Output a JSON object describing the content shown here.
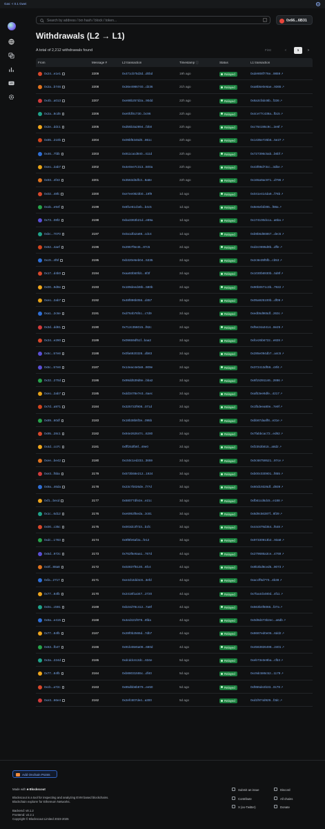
{
  "topbar": {
    "gas": "Gas: < 0.1 Gwei"
  },
  "search": {
    "placeholder": "Search by address / txn hash / block / token...",
    "kbd": "/"
  },
  "wallet": {
    "address": "0x66...6B31"
  },
  "page": {
    "title": "Withdrawals (L2 → L1)",
    "total_text": "A total of 2,212 withdrawals found"
  },
  "pagination": {
    "first": "First",
    "prev": "<",
    "current": "1",
    "next": ">"
  },
  "table": {
    "headers": {
      "from": "From",
      "msg": "Message #",
      "l2": "L2 transaction",
      "ts": "Timestamp",
      "status": "Status",
      "l1": "L1 transaction"
    },
    "rows": [
      {
        "from": "0x24...e1e1",
        "msg": "2209",
        "l2": "0x471cb75d3d...d0bd",
        "ts": "19h ago",
        "status": "Relayed",
        "l1": "0xde908f776e...9859",
        "av": "#d9472b"
      },
      {
        "from": "0x2a...b746",
        "msg": "2208",
        "l2": "0x36e4986740...d236",
        "ts": "21h ago",
        "status": "Relayed",
        "l1": "0xa8b5e0e6ae...9365",
        "av": "#e0731f"
      },
      {
        "from": "0x4b...a013",
        "msg": "2207",
        "l2": "0xe88b257d2a...90dd",
        "ts": "22h ago",
        "status": "Relayed",
        "l1": "0x8a3cfab46b...f336",
        "av": "#d23b3b"
      },
      {
        "from": "0x2a...8cd5",
        "msg": "2206",
        "l2": "0xe0fdf4c730...bc96",
        "ts": "22h ago",
        "status": "Relayed",
        "l1": "0x4ce77c439a...fb15",
        "av": "#1fa38a"
      },
      {
        "from": "0x2e...ddc1",
        "msg": "2205",
        "ts": "22h ago",
        "l2": "0xd55b3a2894...f2b0",
        "status": "Relayed",
        "l1": "0xc764195c9c...2e6f",
        "av": "#f0a61c"
      },
      {
        "from": "0x85...210b",
        "msg": "2204",
        "l2": "0x09bf6346d0...861c",
        "ts": "22h ago",
        "status": "Relayed",
        "l1": "0x1435e725b5...5e27",
        "av": "#d2451e"
      },
      {
        "from": "0x46...7fdb",
        "msg": "2203",
        "l2": "0x911cacd840...411d",
        "ts": "22h ago",
        "status": "Relayed",
        "l1": "0x727396c5ab...b6bf",
        "av": "#2e6fd6"
      },
      {
        "from": "0xeo...2ab7",
        "msg": "2202",
        "l2": "0x4e0ee7c313...500a",
        "ts": "22h ago",
        "status": "Relayed",
        "l1": "0x43f86d73cc...3dbe",
        "av": "#e8a317"
      },
      {
        "from": "0x93...4f43",
        "msg": "2201",
        "l2": "0x3563d3dfc3...8a8e",
        "ts": "22h ago",
        "status": "Relayed",
        "l1": "0x165a9ac971...d796",
        "av": "#e0731f"
      },
      {
        "from": "0x02...48fc",
        "msg": "2200",
        "l2": "0xe7ee0823b0...19f9",
        "ts": "1d ago",
        "status": "Relayed",
        "l1": "0x041e414da9...f76b",
        "av": "#d9472b"
      },
      {
        "from": "0xob...e94f",
        "msg": "2199",
        "l2": "0x6f1e61cbeb...b4c5",
        "ts": "1d ago",
        "status": "Relayed",
        "l1": "0x8e6efaf285...f88a",
        "av": "#27a34a"
      },
      {
        "from": "0x73...08f2",
        "msg": "2198",
        "l2": "0xba3363b21d...e89a",
        "ts": "1d ago",
        "status": "Relayed",
        "l1": "0x174100dcca...a6ba",
        "av": "#5a4fd6"
      },
      {
        "from": "0xbc...7070",
        "msg": "2197",
        "l2": "0x0a1dfa2a88...cdc4",
        "ts": "1d ago",
        "status": "Relayed",
        "l1": "0xb9b6d66867...dec5",
        "av": "#1fa38a"
      },
      {
        "from": "0x62...4aef",
        "msg": "2196",
        "l2": "0x2957f9e46...87c5",
        "ts": "2d ago",
        "status": "Relayed",
        "l1": "0xd2c0695d9b...dffe",
        "av": "#d2451e"
      },
      {
        "from": "0xc9...4f5f",
        "msg": "2195",
        "l2": "0xb320e5eb04...5335",
        "ts": "2d ago",
        "status": "Relayed",
        "l1": "0x2c8e39f5fb...cb53",
        "av": "#2e6fd6"
      },
      {
        "from": "0x17...d4b0",
        "msg": "2194",
        "l2": "0xaa93b50fdc...6f3f",
        "ts": "2d ago",
        "status": "Relayed",
        "l1": "0x1030b6930b...5d8f",
        "av": "#d9472b"
      },
      {
        "from": "0x00...9d9e",
        "msg": "2193",
        "l2": "0x189deed48b...580b",
        "ts": "2d ago",
        "status": "Relayed",
        "l1": "0x90b0671c3b...7922",
        "av": "#f0a61c"
      },
      {
        "from": "0xeo...2ab7",
        "msg": "2192",
        "l2": "0x48f896b056...d457",
        "ts": "2d ago",
        "status": "Relayed",
        "l1": "0x05a925100b...df09",
        "av": "#e8a317"
      },
      {
        "from": "0xa1...2c6e",
        "msg": "2191",
        "l2": "0xd764b76f4c...c7d9",
        "ts": "2d ago",
        "status": "Relayed",
        "l1": "0xedb5d965df...263c",
        "av": "#2e6fd6"
      },
      {
        "from": "0x3d...dd81",
        "msg": "2190",
        "l2": "0x712c356015...f82c",
        "ts": "2d ago",
        "status": "Relayed",
        "l1": "0xf5e24a3414...8e25",
        "av": "#d23b3b"
      },
      {
        "from": "0x34...e290",
        "msg": "2189",
        "l2": "0x09659df51f...baa2",
        "ts": "2d ago",
        "status": "Relayed",
        "l1": "0xfce26b6722...e828",
        "av": "#d9472b"
      },
      {
        "from": "0x6c...57e8",
        "msg": "2188",
        "l2": "0x0fa6920328...db83",
        "ts": "2d ago",
        "status": "Relayed",
        "l1": "0x285e094db7...a4c5",
        "av": "#5a4fd6"
      },
      {
        "from": "0x5c...57e8",
        "msg": "2187",
        "l2": "0x14eac4e0a9...909e",
        "ts": "2d ago",
        "status": "Relayed",
        "l1": "0x372413df59...c8f4",
        "av": "#5a4fd6"
      },
      {
        "from": "0x32...270d",
        "msg": "2186",
        "l2": "0x99dd539d8e...bba2",
        "ts": "2d ago",
        "status": "Relayed",
        "l1": "0x6f15391146...2886",
        "av": "#27a34a"
      },
      {
        "from": "0xeo...2ab7",
        "msg": "2185",
        "l2": "0xdd3478e7e3...6aec",
        "ts": "2d ago",
        "status": "Relayed",
        "l1": "0xafb3ee9dfe...4217",
        "av": "#e8a317"
      },
      {
        "from": "0x7d...a971",
        "msg": "2184",
        "l2": "0x325722f908...071d",
        "ts": "2d ago",
        "status": "Relayed",
        "l1": "0x1fbdeea80e...7e9f",
        "av": "#d2451e"
      },
      {
        "from": "0x89...60df",
        "msg": "2183",
        "l2": "0x18b38b6f3e...095b",
        "ts": "2d ago",
        "status": "Relayed",
        "l1": "0xbb87daaff8...e31e",
        "av": "#27a34a"
      },
      {
        "from": "0x95...28c1",
        "msg": "2182",
        "l2": "0x94e262647c...6280",
        "ts": "2d ago",
        "status": "Relayed",
        "l1": "0x7fabbcac72...ed92",
        "av": "#d9472b"
      },
      {
        "from": "0x4d...co7c",
        "msg": "2181",
        "l2": "0xfff253fb6f...49e0",
        "ts": "2d ago",
        "status": "Relayed",
        "l1": "0xf2353b815...a8d2",
        "av": "#f0a61c"
      },
      {
        "from": "0xee...be42",
        "msg": "2180",
        "l2": "0xc50c1ed233...3659",
        "ts": "2d ago",
        "status": "Relayed",
        "l1": "0x0c68759521...97ce",
        "av": "#e0731f"
      },
      {
        "from": "0xe3...f5ba",
        "msg": "2179",
        "l2": "0x573b58e212...1924",
        "ts": "3d ago",
        "status": "Relayed",
        "l1": "0xb00c030901...f855",
        "av": "#d23b3b"
      },
      {
        "from": "0x9a...46da",
        "msg": "2178",
        "l2": "0x23c7b026de...f77d",
        "ts": "3d ago",
        "status": "Relayed",
        "l1": "0x60d19326df...d939",
        "av": "#2e6fd6"
      },
      {
        "from": "0xf1...becd",
        "msg": "2177",
        "l2": "0x68077dfe2e...e21c",
        "ts": "3d ago",
        "status": "Relayed",
        "l1": "0xfb61cd6dc5...e188",
        "av": "#f0a61c"
      },
      {
        "from": "0x1c...6d12",
        "msg": "2176",
        "l2": "0xe6953f5eda...3c81",
        "ts": "3d ago",
        "status": "Relayed",
        "l1": "0x8d9c56387f...8f39",
        "av": "#1fa38a"
      },
      {
        "from": "0x00...c35c",
        "msg": "2175",
        "l2": "0x003dc3f723...b1fc",
        "ts": "3d ago",
        "status": "Relayed",
        "l1": "0x44c879d354...f648",
        "av": "#d9472b"
      },
      {
        "from": "0xdc...1783",
        "msg": "2174",
        "l2": "0x9f8fe6af2a...fe12",
        "ts": "3d ago",
        "status": "Relayed",
        "l1": "0x97330913b2...93a8",
        "av": "#27a34a"
      },
      {
        "from": "0x5d...972c",
        "msg": "2173",
        "l2": "0x762f5e6aa1...767d",
        "ts": "4d ago",
        "status": "Relayed",
        "l1": "0x279686a3ce...4769",
        "av": "#5a4fd6"
      },
      {
        "from": "0x0f...88a8",
        "msg": "2172",
        "l2": "0x02837f6130...6fc4",
        "ts": "4d ago",
        "status": "Relayed",
        "l1": "0x9b3bd9ced5...9073",
        "av": "#e0731f"
      },
      {
        "from": "0xfa...2717",
        "msg": "2171",
        "l2": "0xe4cb2dd4c8...3efd",
        "ts": "4d ago",
        "status": "Relayed",
        "l1": "0xaccff5d770...4b38",
        "av": "#2e6fd6"
      },
      {
        "from": "0x77...84fb",
        "msg": "2170",
        "l2": "0x2418f1a347...2720",
        "ts": "4d ago",
        "status": "Relayed",
        "l1": "0x7ba4cb480d...4f11",
        "av": "#f0a61c"
      },
      {
        "from": "0x0o...c591",
        "msg": "2169",
        "l2": "0xb24d78c412...7a8f",
        "ts": "4d ago",
        "status": "Relayed",
        "l1": "0x563b4f6066...f27a",
        "av": "#1fa38a"
      },
      {
        "from": "0x9a...e415",
        "msg": "2168",
        "l2": "0x4ed421f878...8fda",
        "ts": "4d ago",
        "status": "Relayed",
        "l1": "0x0d9d473b2ec...a6db",
        "av": "#2e6fd6"
      },
      {
        "from": "0x77...84fb",
        "msg": "2167",
        "l2": "0x28f0b2565d...7db7",
        "ts": "4d ago",
        "status": "Relayed",
        "l1": "0x8687ed0e06...6dd2",
        "av": "#f0a61c"
      },
      {
        "from": "0x63...fb47",
        "msg": "2166",
        "l2": "0x91b48e6a08...680d",
        "ts": "4d ago",
        "status": "Relayed",
        "l1": "0x4563826498...2401",
        "av": "#27a34a"
      },
      {
        "from": "0x3a...224d",
        "msg": "2165",
        "l2": "0xdcddc4c2dc...634e",
        "ts": "5d ago",
        "status": "Relayed",
        "l1": "0xeb73e3e9ba...cfb3",
        "av": "#1fa38a"
      },
      {
        "from": "0x77...84fb",
        "msg": "2164",
        "l2": "0xb88031555c...df40",
        "ts": "5d ago",
        "status": "Relayed",
        "l1": "0xc9dc586c52...1179",
        "av": "#f0a61c"
      },
      {
        "from": "0xcb...a72c",
        "msg": "2163",
        "l2": "0x85dbb6b879...ee50",
        "ts": "5d ago",
        "status": "Relayed",
        "l1": "0xf855de2b33...0c78",
        "av": "#d9472b"
      },
      {
        "from": "0xe3...66e4",
        "msg": "2162",
        "l2": "0x2efc807de4...a300",
        "ts": "5d ago",
        "status": "Relayed",
        "l1": "0xd1f974d929...f3dc",
        "av": "#d23b3b"
      }
    ]
  },
  "footer": {
    "points_button": "Add Onchain Points",
    "made_with": "Made with",
    "brand": "Blockscout",
    "desc1": "Blockscout is a tool for inspecting and analyzing EVM based blockchains.",
    "desc2": "Blockchain explorer for Ethereum Networks.",
    "backend": "Backend: v8.1.2",
    "frontend": "Frontend: v2.2.1",
    "copyright": "Copyright © Blockscout Limited 2023-2025",
    "links": {
      "submit_issue": "Submit an issue",
      "contribute": "Contribute",
      "twitter": "X (ex-Twitter)",
      "discord": "Discord",
      "all_chains": "All chains",
      "donate": "Donate"
    }
  }
}
